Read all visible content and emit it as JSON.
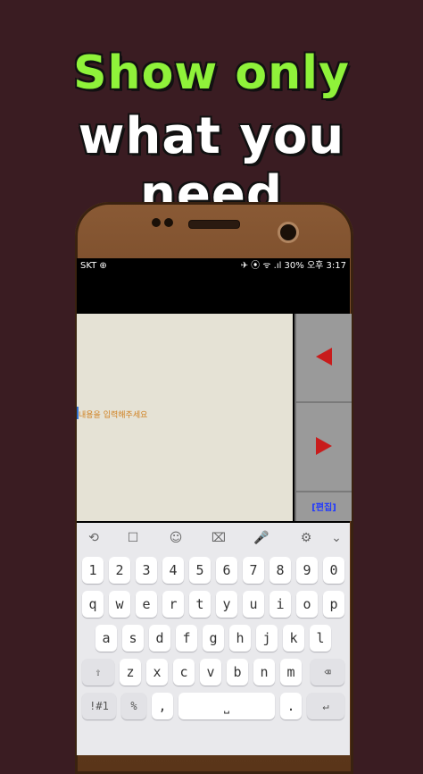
{
  "headline": {
    "line1": "Show only",
    "line2": "what you need"
  },
  "status": {
    "left": "SKT ⊕",
    "right": "✈ ⦿ ᯤ .ıl 30% 오후 3:17"
  },
  "editor": {
    "placeholder_text": "내용을 입력해주세요",
    "up_arrow": "◀",
    "down_arrow": "▶",
    "small_button": "[편집]"
  },
  "keyboard": {
    "toolbar": [
      "⟲",
      "☐",
      "☺",
      "⌧",
      "🎤",
      "⚙",
      "⌄"
    ],
    "row_numbers": [
      "1",
      "2",
      "3",
      "4",
      "5",
      "6",
      "7",
      "8",
      "9",
      "0"
    ],
    "row_q": [
      "q",
      "w",
      "e",
      "r",
      "t",
      "y",
      "u",
      "i",
      "o",
      "p"
    ],
    "row_a": [
      "a",
      "s",
      "d",
      "f",
      "g",
      "h",
      "j",
      "k",
      "l"
    ],
    "row_z": [
      "z",
      "x",
      "c",
      "v",
      "b",
      "n",
      "m"
    ],
    "shift": "⇧",
    "backspace": "⌫",
    "bottom": {
      "sym": "!#1",
      "lang": "%",
      "comma": ",",
      "space": "⎵",
      "period": ".",
      "enter": "↵"
    }
  }
}
